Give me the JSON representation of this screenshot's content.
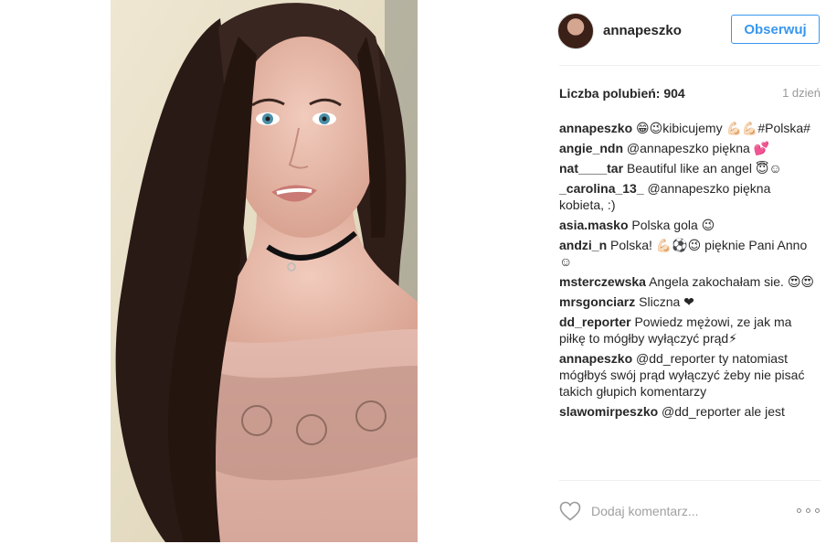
{
  "post": {
    "username": "annapeszko",
    "follow_label": "Obserwuj",
    "likes": "Liczba polubień: 904",
    "time": "1 dzień"
  },
  "comments": [
    {
      "user": "annapeszko",
      "text": "😁😉kibicujemy 💪🏻💪🏻#Polska#"
    },
    {
      "user": "angie_ndn",
      "text": "@annapeszko piękna 💕"
    },
    {
      "user": "nat____tar",
      "text": "Beautiful like an angel 😇☺"
    },
    {
      "user": "_carolina_13_",
      "text": "@annapeszko piękna kobieta, :)"
    },
    {
      "user": "asia.masko",
      "text": "Polska gola 😉"
    },
    {
      "user": "andzi_n",
      "text": "Polska! 💪🏻⚽😉 pięknie Pani Anno ☺"
    },
    {
      "user": "msterczewska",
      "text": "Angela zakochałam sie. 😍😍"
    },
    {
      "user": "mrsgonciarz",
      "text": "Sliczna ❤"
    },
    {
      "user": "dd_reporter",
      "text": "Powiedz mężowi, ze jak ma piłkę to mógłby wyłączyć prąd⚡"
    },
    {
      "user": "annapeszko",
      "text": "@dd_reporter ty natomiast mógłbyś swój prąd wyłączyć żeby nie pisać takich głupich komentarzy"
    },
    {
      "user": "slawomirpeszko",
      "text": "@dd_reporter ale jest"
    }
  ],
  "input": {
    "placeholder": "Dodaj komentarz..."
  },
  "icons": {
    "like": "heart-outline-icon",
    "more": "more-options-icon"
  },
  "colors": {
    "accent": "#3897f0",
    "muted": "#999999",
    "divider": "#efefef"
  }
}
